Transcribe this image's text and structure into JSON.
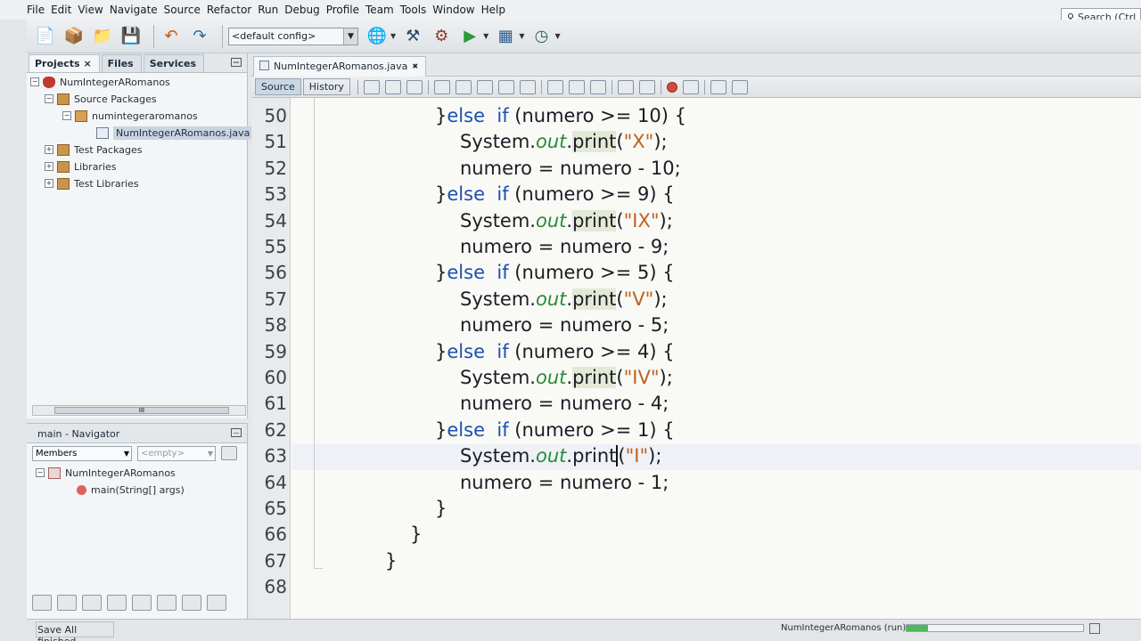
{
  "menu": [
    "File",
    "Edit",
    "View",
    "Navigate",
    "Source",
    "Refactor",
    "Run",
    "Debug",
    "Profile",
    "Team",
    "Tools",
    "Window",
    "Help"
  ],
  "search": {
    "placeholder": "Search (Ctrl"
  },
  "toolbar": {
    "config_value": "<default config>"
  },
  "left_tabs": {
    "projects": "Projects",
    "files": "Files",
    "services": "Services"
  },
  "project_tree": [
    "NumIntegerARomanos",
    "Source Packages",
    "numintegeraromanos",
    "NumIntegerARomanos.java",
    "Test Packages",
    "Libraries",
    "Test Libraries"
  ],
  "h_scroll_label": "III",
  "navigator": {
    "title": "main - Navigator",
    "filter": "Members",
    "empty": "<empty>",
    "items": [
      "NumIntegerARomanos",
      "main(String[] args)"
    ]
  },
  "editor": {
    "tab": "NumIntegerARomanos.java",
    "source_btn": "Source",
    "history_btn": "History"
  },
  "code_lines": [
    {
      "n": "50",
      "indent": 1,
      "tokens": [
        [
          "",
          "}"
        ],
        [
          "kw",
          "else"
        ],
        [
          "",
          "  "
        ],
        [
          "kw",
          "if"
        ],
        [
          "",
          " (numero >= 10) {"
        ]
      ]
    },
    {
      "n": "51",
      "indent": 2,
      "tokens": [
        [
          "",
          "System."
        ],
        [
          "fld",
          "out"
        ],
        [
          "",
          "."
        ],
        [
          "mhl",
          "print"
        ],
        [
          "",
          "("
        ],
        [
          "str",
          "\"X\""
        ],
        [
          "",
          ");"
        ]
      ]
    },
    {
      "n": "52",
      "indent": 2,
      "tokens": [
        [
          "",
          "numero = numero - 10;"
        ]
      ]
    },
    {
      "n": "53",
      "indent": 1,
      "tokens": [
        [
          "",
          "}"
        ],
        [
          "kw",
          "else"
        ],
        [
          "",
          "  "
        ],
        [
          "kw",
          "if"
        ],
        [
          "",
          " (numero >= 9) {"
        ]
      ]
    },
    {
      "n": "54",
      "indent": 2,
      "tokens": [
        [
          "",
          "System."
        ],
        [
          "fld",
          "out"
        ],
        [
          "",
          "."
        ],
        [
          "mhl",
          "print"
        ],
        [
          "",
          "("
        ],
        [
          "str",
          "\"IX\""
        ],
        [
          "",
          ");"
        ]
      ]
    },
    {
      "n": "55",
      "indent": 2,
      "tokens": [
        [
          "",
          "numero = numero - 9;"
        ]
      ]
    },
    {
      "n": "56",
      "indent": 1,
      "tokens": [
        [
          "",
          "}"
        ],
        [
          "kw",
          "else"
        ],
        [
          "",
          "  "
        ],
        [
          "kw",
          "if"
        ],
        [
          "",
          " (numero >= 5) {"
        ]
      ]
    },
    {
      "n": "57",
      "indent": 2,
      "tokens": [
        [
          "",
          "System."
        ],
        [
          "fld",
          "out"
        ],
        [
          "",
          "."
        ],
        [
          "mhl",
          "print"
        ],
        [
          "",
          "("
        ],
        [
          "str",
          "\"V\""
        ],
        [
          "",
          ");"
        ]
      ]
    },
    {
      "n": "58",
      "indent": 2,
      "tokens": [
        [
          "",
          "numero = numero - 5;"
        ]
      ]
    },
    {
      "n": "59",
      "indent": 1,
      "tokens": [
        [
          "",
          "}"
        ],
        [
          "kw",
          "else"
        ],
        [
          "",
          "  "
        ],
        [
          "kw",
          "if"
        ],
        [
          "",
          " (numero >= 4) {"
        ]
      ]
    },
    {
      "n": "60",
      "indent": 2,
      "tokens": [
        [
          "",
          "System."
        ],
        [
          "fld",
          "out"
        ],
        [
          "",
          "."
        ],
        [
          "mhl",
          "print"
        ],
        [
          "",
          "("
        ],
        [
          "str",
          "\"IV\""
        ],
        [
          "",
          ");"
        ]
      ]
    },
    {
      "n": "61",
      "indent": 2,
      "tokens": [
        [
          "",
          "numero = numero - 4;"
        ]
      ]
    },
    {
      "n": "62",
      "indent": 1,
      "tokens": [
        [
          "",
          "}"
        ],
        [
          "kw",
          "else"
        ],
        [
          "",
          "  "
        ],
        [
          "kw",
          "if"
        ],
        [
          "",
          " (numero >= 1) {"
        ]
      ]
    },
    {
      "n": "63",
      "indent": 2,
      "tokens": [
        [
          "",
          "System."
        ],
        [
          "fld",
          "out"
        ],
        [
          "",
          "."
        ],
        [
          "",
          "print"
        ],
        [
          "cursor",
          "("
        ],
        [
          "str",
          "\"I\""
        ],
        [
          "",
          ");"
        ]
      ]
    },
    {
      "n": "64",
      "indent": 2,
      "tokens": [
        [
          "",
          "numero = numero - 1;"
        ]
      ]
    },
    {
      "n": "65",
      "indent": 1,
      "tokens": [
        [
          "",
          "}"
        ]
      ]
    },
    {
      "n": "66",
      "indent": 0,
      "tokens": [
        [
          "",
          "}"
        ]
      ]
    },
    {
      "n": "67",
      "indent": -1,
      "tokens": [
        [
          "",
          "}"
        ]
      ]
    },
    {
      "n": "68",
      "indent": 0,
      "tokens": []
    }
  ],
  "status": {
    "left": "Save All finished.",
    "task": "NumIntegerARomanos (run)",
    "progress_fraction": 0.12
  }
}
